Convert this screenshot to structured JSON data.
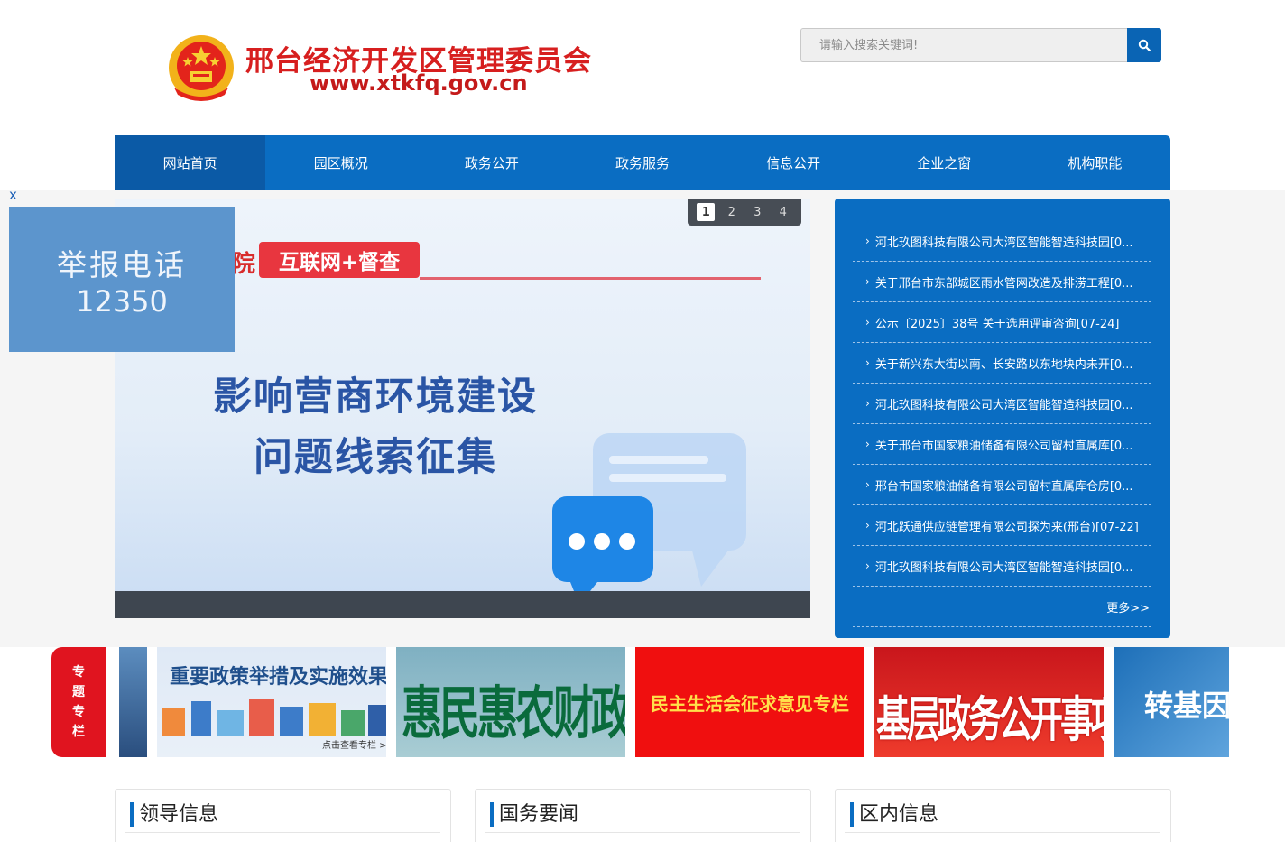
{
  "header": {
    "site_title": "邢台经济开发区管理委员会",
    "site_url": "www.xtkfq.gov.cn",
    "search_placeholder": "请输入搜索关键词!"
  },
  "nav": {
    "items": [
      "网站首页",
      "园区概况",
      "政务公开",
      "政务服务",
      "信息公开",
      "企业之窗",
      "机构职能"
    ],
    "active_index": 0
  },
  "slider": {
    "tag_prefix": "院",
    "tag": "互联网+督查",
    "headline_1": "影响营商环境建设",
    "headline_2": "问题线索征集",
    "pages": [
      "1",
      "2",
      "3",
      "4"
    ],
    "active_page": 1
  },
  "float_ad": {
    "close": "x",
    "line_1": "举报电话",
    "line_2": "12350"
  },
  "news": {
    "items": [
      "河北玖图科技有限公司大湾区智能智造科技园[0...",
      "关于邢台市东部城区雨水管网改造及排涝工程[0...",
      "公示〔2025〕38号 关于选用评审咨询[07-24]",
      "关于新兴东大街以南、长安路以东地块内未开[0...",
      "河北玖图科技有限公司大湾区智能智造科技园[0...",
      "关于邢台市国家粮油储备有限公司留村直属库[0...",
      "邢台市国家粮油储备有限公司留村直属库仓房[0...",
      "河北跃通供应链管理有限公司探为来(邢台)[07-22]",
      "河北玖图科技有限公司大湾区智能智造科技园[0..."
    ],
    "more": "更多>>"
  },
  "topics": {
    "tab_chars": [
      "专",
      "题",
      "专",
      "栏"
    ],
    "banner_1_title": "重要政策举措及实施效果",
    "banner_1_sub": "点击查看专栏 >>",
    "banner_2_title": "惠民惠农财政补贴",
    "banner_3_title": "民主生活会征求意见专栏",
    "banner_4_title": "基层政务公开事项目录",
    "banner_5_title": "转基因标"
  },
  "sections": [
    "领导信息",
    "国务要闻",
    "区内信息"
  ],
  "colors": {
    "brand_blue": "#0a6dc2",
    "title_red": "#d71f1f",
    "topic_red": "#e0141f"
  }
}
